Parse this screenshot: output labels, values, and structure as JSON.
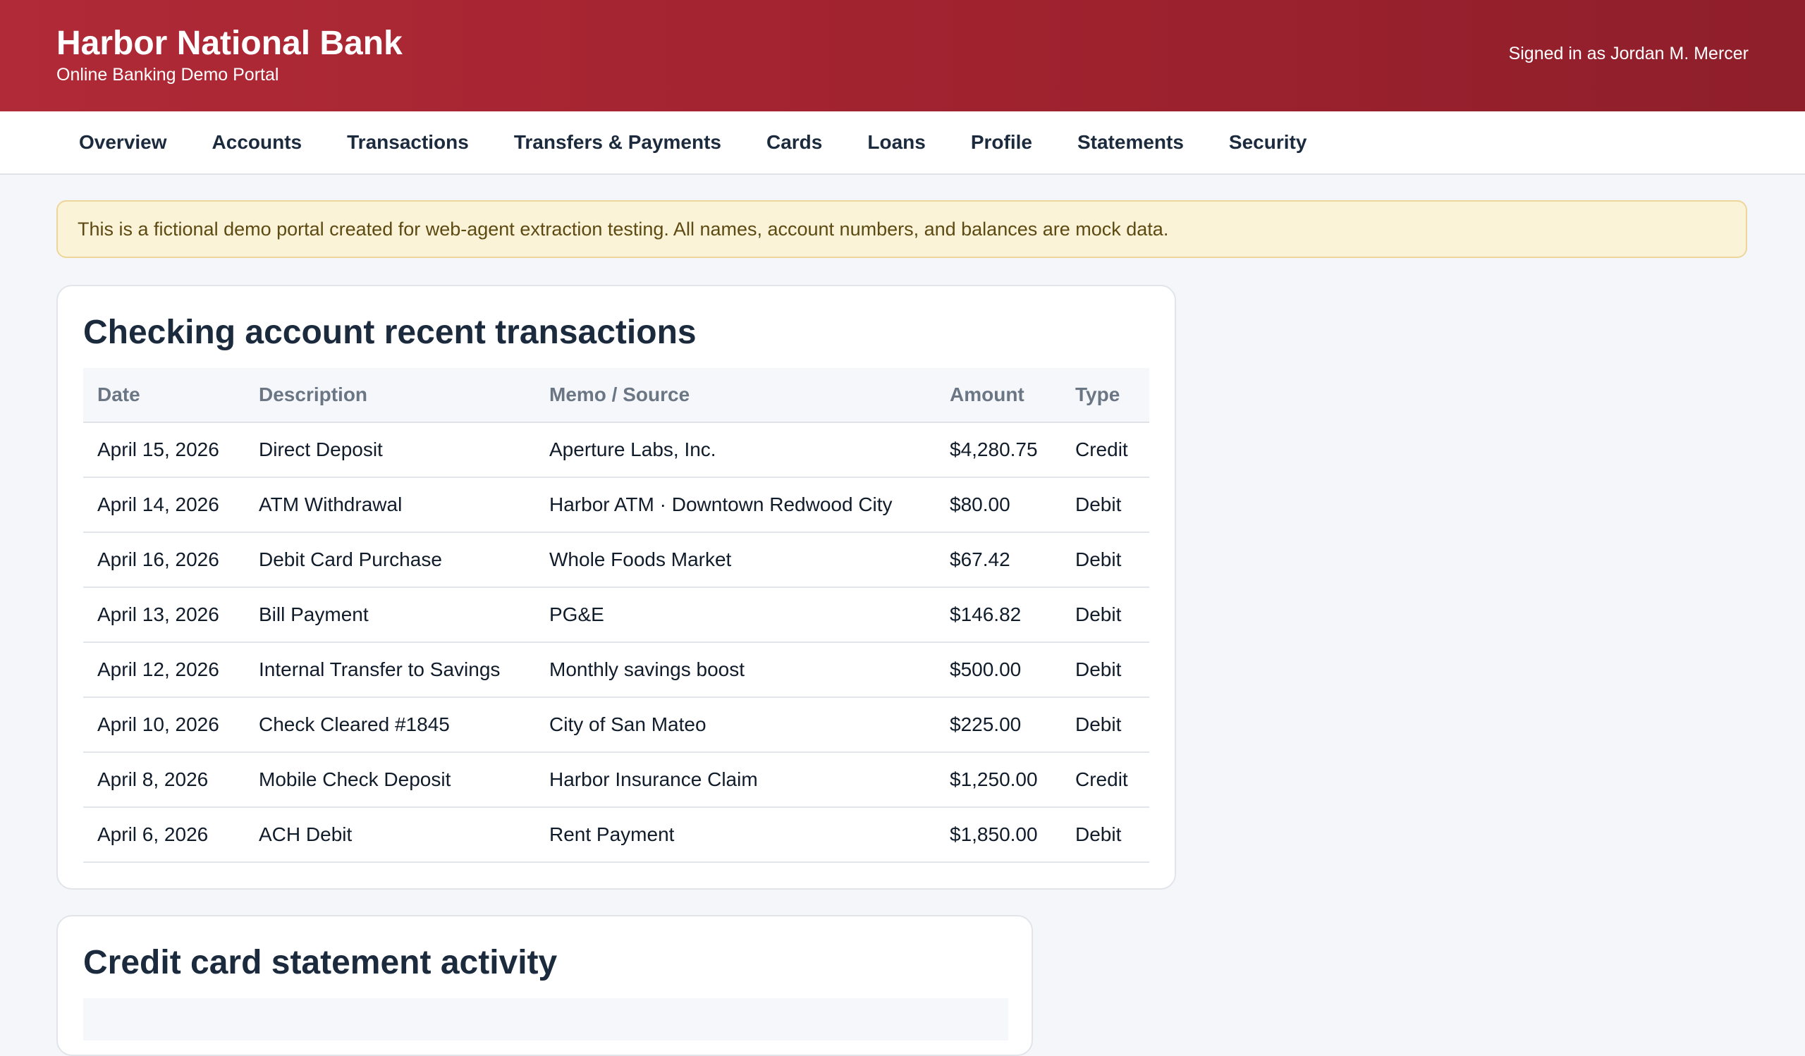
{
  "header": {
    "bank_name": "Harbor National Bank",
    "subtitle": "Online Banking Demo Portal",
    "signed_in": "Signed in as Jordan M. Mercer"
  },
  "nav": [
    "Overview",
    "Accounts",
    "Transactions",
    "Transfers & Payments",
    "Cards",
    "Loans",
    "Profile",
    "Statements",
    "Security"
  ],
  "notice": "This is a fictional demo portal created for web-agent extraction testing. All names, account numbers, and balances are mock data.",
  "checking": {
    "title": "Checking account recent transactions",
    "columns": [
      "Date",
      "Description",
      "Memo / Source",
      "Amount",
      "Type"
    ],
    "rows": [
      [
        "April 15, 2026",
        "Direct Deposit",
        "Aperture Labs, Inc.",
        "$4,280.75",
        "Credit"
      ],
      [
        "April 14, 2026",
        "ATM Withdrawal",
        "Harbor ATM · Downtown Redwood City",
        "$80.00",
        "Debit"
      ],
      [
        "April 16, 2026",
        "Debit Card Purchase",
        "Whole Foods Market",
        "$67.42",
        "Debit"
      ],
      [
        "April 13, 2026",
        "Bill Payment",
        "PG&E",
        "$146.82",
        "Debit"
      ],
      [
        "April 12, 2026",
        "Internal Transfer to Savings",
        "Monthly savings boost",
        "$500.00",
        "Debit"
      ],
      [
        "April 10, 2026",
        "Check Cleared #1845",
        "City of San Mateo",
        "$225.00",
        "Debit"
      ],
      [
        "April 8, 2026",
        "Mobile Check Deposit",
        "Harbor Insurance Claim",
        "$1,250.00",
        "Credit"
      ],
      [
        "April 6, 2026",
        "ACH Debit",
        "Rent Payment",
        "$1,850.00",
        "Debit"
      ]
    ]
  },
  "credit": {
    "title": "Credit card statement activity"
  },
  "colors": {
    "header_start": "#b02a37",
    "header_end": "#8e1f2b",
    "notice_bg": "#fbf3d8"
  }
}
